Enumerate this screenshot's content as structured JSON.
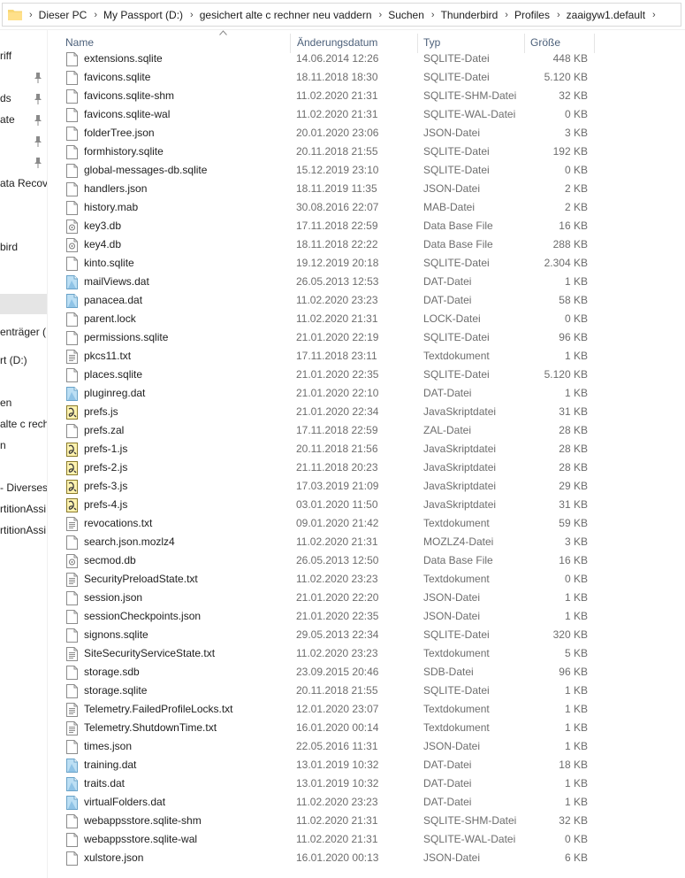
{
  "breadcrumb": [
    "Dieser PC",
    "My Passport (D:)",
    "gesichert alte c rechner neu vaddern",
    "Suchen",
    "Thunderbird",
    "Profiles",
    "zaaigyw1.default"
  ],
  "sidebar": {
    "items": [
      "riff",
      "ds",
      "ate",
      "ata Recove",
      "bird",
      "enträger (",
      "rt (D:)",
      "en",
      "alte c rech",
      "n",
      "- Diverses",
      "rtitionAssi",
      "rtitionAssi"
    ]
  },
  "columns": {
    "name": "Name",
    "date": "Änderungsdatum",
    "type": "Typ",
    "size": "Größe"
  },
  "files": [
    {
      "name": "extensions.sqlite",
      "date": "14.06.2014 12:26",
      "type": "SQLITE-Datei",
      "size": "448 KB",
      "icon": "generic-file"
    },
    {
      "name": "favicons.sqlite",
      "date": "18.11.2018 18:30",
      "type": "SQLITE-Datei",
      "size": "5.120 KB",
      "icon": "generic-file"
    },
    {
      "name": "favicons.sqlite-shm",
      "date": "11.02.2020 21:31",
      "type": "SQLITE-SHM-Datei",
      "size": "32 KB",
      "icon": "generic-file"
    },
    {
      "name": "favicons.sqlite-wal",
      "date": "11.02.2020 21:31",
      "type": "SQLITE-WAL-Datei",
      "size": "0 KB",
      "icon": "generic-file"
    },
    {
      "name": "folderTree.json",
      "date": "20.01.2020 23:06",
      "type": "JSON-Datei",
      "size": "3 KB",
      "icon": "generic-file"
    },
    {
      "name": "formhistory.sqlite",
      "date": "20.11.2018 21:55",
      "type": "SQLITE-Datei",
      "size": "192 KB",
      "icon": "generic-file"
    },
    {
      "name": "global-messages-db.sqlite",
      "date": "15.12.2019 23:10",
      "type": "SQLITE-Datei",
      "size": "0 KB",
      "icon": "generic-file"
    },
    {
      "name": "handlers.json",
      "date": "18.11.2019 11:35",
      "type": "JSON-Datei",
      "size": "2 KB",
      "icon": "generic-file"
    },
    {
      "name": "history.mab",
      "date": "30.08.2016 22:07",
      "type": "MAB-Datei",
      "size": "2 KB",
      "icon": "generic-file"
    },
    {
      "name": "key3.db",
      "date": "17.11.2018 22:59",
      "type": "Data Base File",
      "size": "16 KB",
      "icon": "database-file"
    },
    {
      "name": "key4.db",
      "date": "18.11.2018 22:22",
      "type": "Data Base File",
      "size": "288 KB",
      "icon": "database-file"
    },
    {
      "name": "kinto.sqlite",
      "date": "19.12.2019 20:18",
      "type": "SQLITE-Datei",
      "size": "2.304 KB",
      "icon": "generic-file"
    },
    {
      "name": "mailViews.dat",
      "date": "26.05.2013 12:53",
      "type": "DAT-Datei",
      "size": "1 KB",
      "icon": "dat-file"
    },
    {
      "name": "panacea.dat",
      "date": "11.02.2020 23:23",
      "type": "DAT-Datei",
      "size": "58 KB",
      "icon": "dat-file"
    },
    {
      "name": "parent.lock",
      "date": "11.02.2020 21:31",
      "type": "LOCK-Datei",
      "size": "0 KB",
      "icon": "generic-file"
    },
    {
      "name": "permissions.sqlite",
      "date": "21.01.2020 22:19",
      "type": "SQLITE-Datei",
      "size": "96 KB",
      "icon": "generic-file"
    },
    {
      "name": "pkcs11.txt",
      "date": "17.11.2018 23:11",
      "type": "Textdokument",
      "size": "1 KB",
      "icon": "text-file"
    },
    {
      "name": "places.sqlite",
      "date": "21.01.2020 22:35",
      "type": "SQLITE-Datei",
      "size": "5.120 KB",
      "icon": "generic-file"
    },
    {
      "name": "pluginreg.dat",
      "date": "21.01.2020 22:10",
      "type": "DAT-Datei",
      "size": "1 KB",
      "icon": "dat-file"
    },
    {
      "name": "prefs.js",
      "date": "21.01.2020 22:34",
      "type": "JavaSkriptdatei",
      "size": "31 KB",
      "icon": "script-file"
    },
    {
      "name": "prefs.zal",
      "date": "17.11.2018 22:59",
      "type": "ZAL-Datei",
      "size": "28 KB",
      "icon": "generic-file"
    },
    {
      "name": "prefs-1.js",
      "date": "20.11.2018 21:56",
      "type": "JavaSkriptdatei",
      "size": "28 KB",
      "icon": "script-file"
    },
    {
      "name": "prefs-2.js",
      "date": "21.11.2018 20:23",
      "type": "JavaSkriptdatei",
      "size": "28 KB",
      "icon": "script-file"
    },
    {
      "name": "prefs-3.js",
      "date": "17.03.2019 21:09",
      "type": "JavaSkriptdatei",
      "size": "29 KB",
      "icon": "script-file"
    },
    {
      "name": "prefs-4.js",
      "date": "03.01.2020 11:50",
      "type": "JavaSkriptdatei",
      "size": "31 KB",
      "icon": "script-file"
    },
    {
      "name": "revocations.txt",
      "date": "09.01.2020 21:42",
      "type": "Textdokument",
      "size": "59 KB",
      "icon": "text-file"
    },
    {
      "name": "search.json.mozlz4",
      "date": "11.02.2020 21:31",
      "type": "MOZLZ4-Datei",
      "size": "3 KB",
      "icon": "generic-file"
    },
    {
      "name": "secmod.db",
      "date": "26.05.2013 12:50",
      "type": "Data Base File",
      "size": "16 KB",
      "icon": "database-file"
    },
    {
      "name": "SecurityPreloadState.txt",
      "date": "11.02.2020 23:23",
      "type": "Textdokument",
      "size": "0 KB",
      "icon": "text-file"
    },
    {
      "name": "session.json",
      "date": "21.01.2020 22:20",
      "type": "JSON-Datei",
      "size": "1 KB",
      "icon": "generic-file"
    },
    {
      "name": "sessionCheckpoints.json",
      "date": "21.01.2020 22:35",
      "type": "JSON-Datei",
      "size": "1 KB",
      "icon": "generic-file"
    },
    {
      "name": "signons.sqlite",
      "date": "29.05.2013 22:34",
      "type": "SQLITE-Datei",
      "size": "320 KB",
      "icon": "generic-file"
    },
    {
      "name": "SiteSecurityServiceState.txt",
      "date": "11.02.2020 23:23",
      "type": "Textdokument",
      "size": "5 KB",
      "icon": "text-file"
    },
    {
      "name": "storage.sdb",
      "date": "23.09.2015 20:46",
      "type": "SDB-Datei",
      "size": "96 KB",
      "icon": "generic-file"
    },
    {
      "name": "storage.sqlite",
      "date": "20.11.2018 21:55",
      "type": "SQLITE-Datei",
      "size": "1 KB",
      "icon": "generic-file"
    },
    {
      "name": "Telemetry.FailedProfileLocks.txt",
      "date": "12.01.2020 23:07",
      "type": "Textdokument",
      "size": "1 KB",
      "icon": "text-file"
    },
    {
      "name": "Telemetry.ShutdownTime.txt",
      "date": "16.01.2020 00:14",
      "type": "Textdokument",
      "size": "1 KB",
      "icon": "text-file"
    },
    {
      "name": "times.json",
      "date": "22.05.2016 11:31",
      "type": "JSON-Datei",
      "size": "1 KB",
      "icon": "generic-file"
    },
    {
      "name": "training.dat",
      "date": "13.01.2019 10:32",
      "type": "DAT-Datei",
      "size": "18 KB",
      "icon": "dat-file"
    },
    {
      "name": "traits.dat",
      "date": "13.01.2019 10:32",
      "type": "DAT-Datei",
      "size": "1 KB",
      "icon": "dat-file"
    },
    {
      "name": "virtualFolders.dat",
      "date": "11.02.2020 23:23",
      "type": "DAT-Datei",
      "size": "1 KB",
      "icon": "dat-file"
    },
    {
      "name": "webappsstore.sqlite-shm",
      "date": "11.02.2020 21:31",
      "type": "SQLITE-SHM-Datei",
      "size": "32 KB",
      "icon": "generic-file"
    },
    {
      "name": "webappsstore.sqlite-wal",
      "date": "11.02.2020 21:31",
      "type": "SQLITE-WAL-Datei",
      "size": "0 KB",
      "icon": "generic-file"
    },
    {
      "name": "xulstore.json",
      "date": "16.01.2020 00:13",
      "type": "JSON-Datei",
      "size": "6 KB",
      "icon": "generic-file"
    }
  ]
}
